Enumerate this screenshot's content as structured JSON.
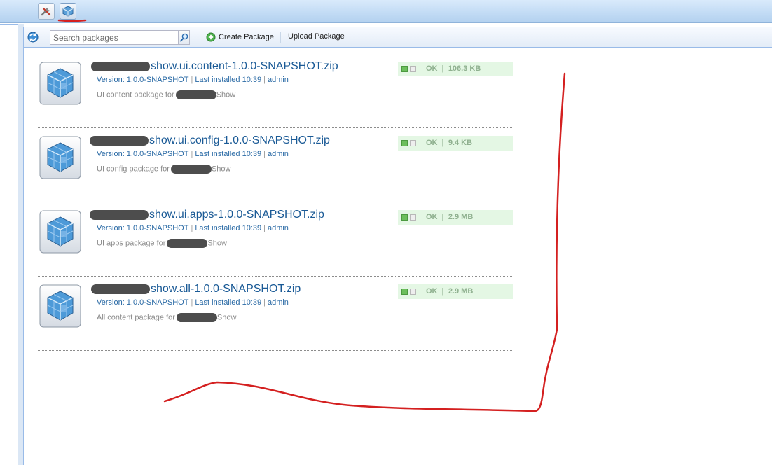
{
  "toolbar": {
    "tools_icon": "tools-icon",
    "packages_icon": "package-cube-icon"
  },
  "main_toolbar": {
    "refresh_icon": "refresh-icon",
    "search_placeholder": "Search packages",
    "search_icon": "magnifier-icon",
    "create_label": "Create Package",
    "create_icon": "add-circle-icon",
    "upload_label": "Upload Package"
  },
  "packages": [
    {
      "title_suffix": "show.ui.content-1.0.0-SNAPSHOT.zip",
      "version": "Version: 1.0.0-SNAPSHOT",
      "installed": "Last installed 10:39",
      "user": "admin",
      "desc_prefix": "UI content package for",
      "desc_suffix": "Show",
      "status": "OK",
      "size": "106.3 KB"
    },
    {
      "title_suffix": "show.ui.config-1.0.0-SNAPSHOT.zip",
      "version": "Version: 1.0.0-SNAPSHOT",
      "installed": "Last installed 10:39",
      "user": "admin",
      "desc_prefix": "UI config package for",
      "desc_suffix": "Show",
      "status": "OK",
      "size": "9.4 KB"
    },
    {
      "title_suffix": "show.ui.apps-1.0.0-SNAPSHOT.zip",
      "version": "Version: 1.0.0-SNAPSHOT",
      "installed": "Last installed 10:39",
      "user": "admin",
      "desc_prefix": "UI apps package for",
      "desc_suffix": "Show",
      "status": "OK",
      "size": "2.9 MB"
    },
    {
      "title_suffix": "show.all-1.0.0-SNAPSHOT.zip",
      "version": "Version: 1.0.0-SNAPSHOT",
      "installed": "Last installed 10:39",
      "user": "admin",
      "desc_prefix": "All content package for",
      "desc_suffix": "Show",
      "status": "OK",
      "size": "2.9 MB"
    }
  ],
  "colors": {
    "annotation": "#d42020",
    "link": "#1a5a96",
    "status_bg": "#e4f7e4"
  }
}
